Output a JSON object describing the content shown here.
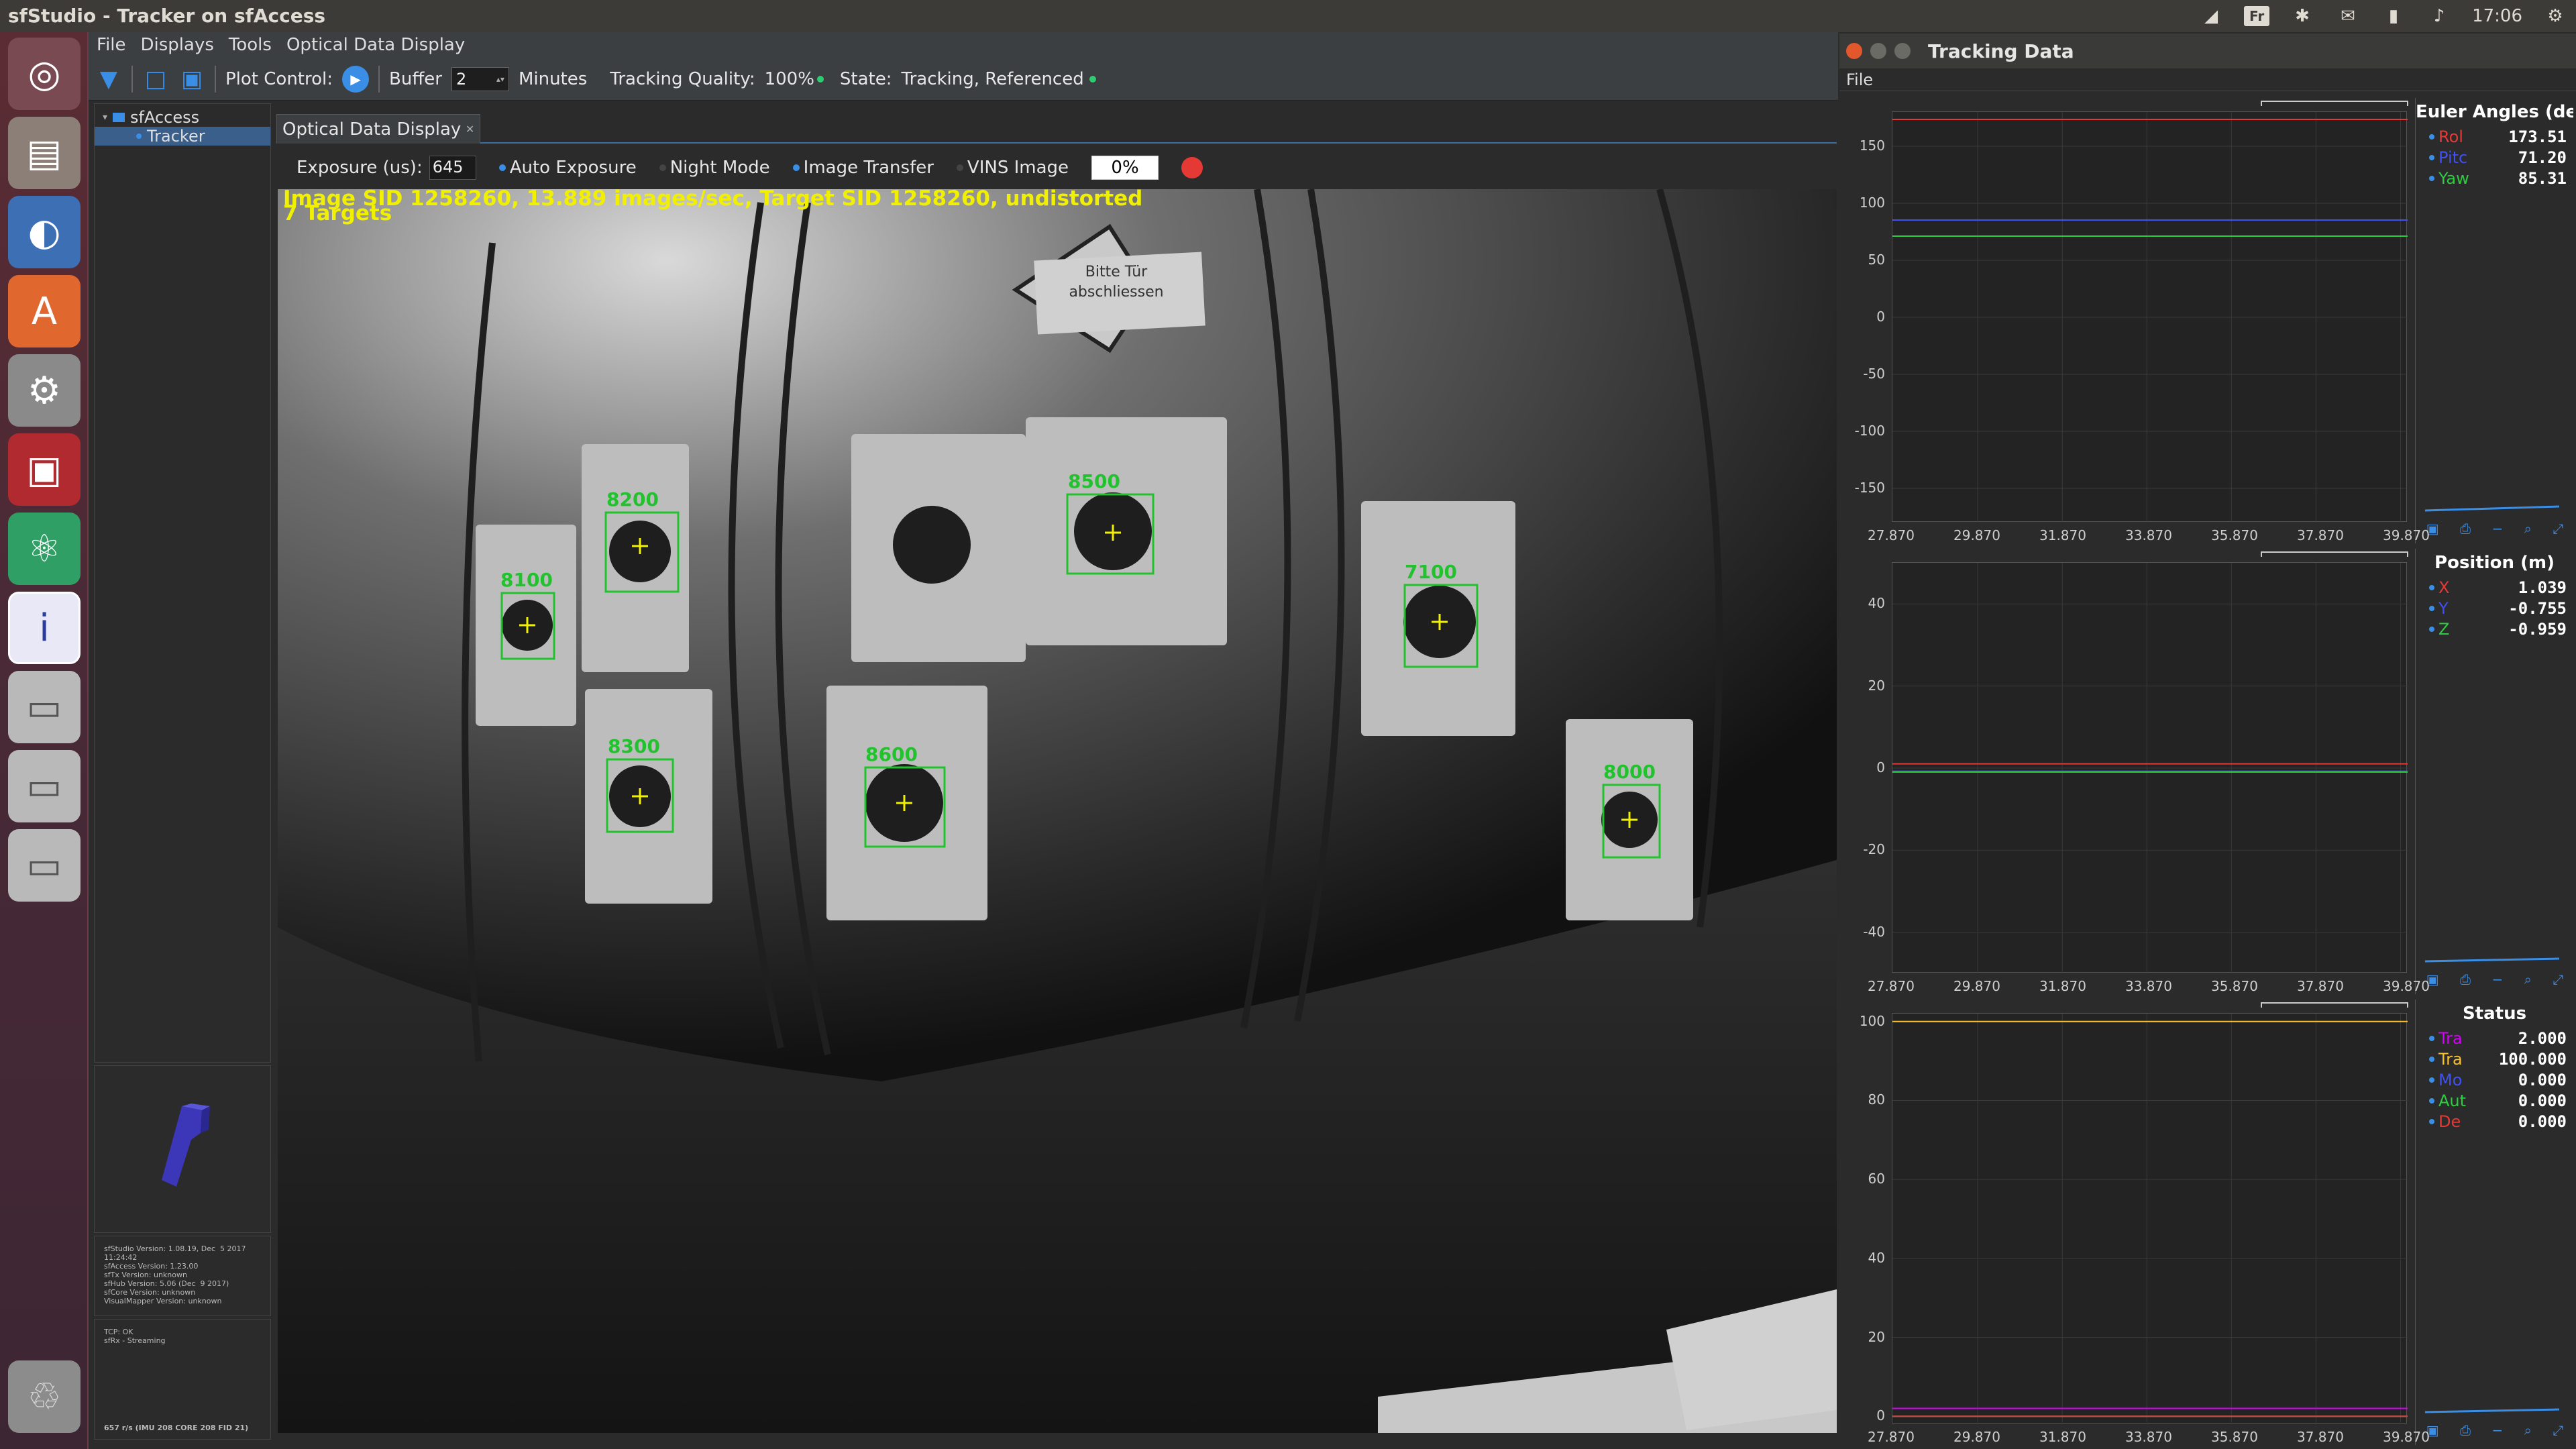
{
  "topbar": {
    "title": "sfStudio - Tracker on sfAccess",
    "keyboard": "Fr",
    "clock": "17:06"
  },
  "launcher": {
    "items": [
      "ubuntu-dash-icon",
      "files-icon",
      "firefox-icon",
      "software-center-icon",
      "system-settings-icon",
      "terminal-icon",
      "atom-icon",
      "sfstudio-icon",
      "drive-icon",
      "drive-icon",
      "drive-icon",
      "trash-icon"
    ]
  },
  "menubar": {
    "items": [
      "File",
      "Displays",
      "Tools",
      "Optical Data Display"
    ]
  },
  "toolbar": {
    "plot_control": "Plot Control:",
    "buffer": "Buffer",
    "buffer_value": "2",
    "minutes": "Minutes",
    "tracking_quality_label": "Tracking Quality:",
    "tracking_quality": "100%",
    "state_label": "State:",
    "state": "Tracking, Referenced"
  },
  "tree": {
    "root": "sfAccess",
    "child": "Tracker"
  },
  "versions": "sfStudio Version: 1.08.19, Dec  5 2017\n11:24:42\nsfAccess Version: 1.23.00\nsfTx Version: unknown\nsfHub Version: 5.06 (Dec  9 2017)\nsfCore Version: unknown\nVisualMapper Version: unknown",
  "status": {
    "tcp": "TCP: OK",
    "rx": "sfRx - Streaming",
    "rate": "657 r/s (IMU 208  CORE 208  FID 21)"
  },
  "optical": {
    "tab": "Optical Data Display",
    "exposure_label": "Exposure (us):",
    "exposure_value": "645",
    "auto_exposure": "Auto Exposure",
    "night_mode": "Night Mode",
    "image_transfer": "Image Transfer",
    "vins_image": "VINS Image",
    "progress": "0%",
    "overlay_line1": "Image SID 1258260, 13.889 images/sec, Target SID 1258260, undistorted",
    "overlay_line2": "7 Targets",
    "sign_text": [
      "Bitte Tür",
      "abschliessen"
    ],
    "targets": [
      "8100",
      "8200",
      "8300",
      "8500",
      "8600",
      "7100",
      "8000"
    ]
  },
  "tracking": {
    "title": "Tracking Data",
    "menu": "File",
    "x_ticks": [
      "27.870",
      "29.870",
      "31.870",
      "33.870",
      "35.870",
      "37.870",
      "39.870"
    ],
    "euler": {
      "title": "Euler Angles (de",
      "rows": [
        {
          "name": "Rol",
          "value": "173.51",
          "color": "#e53935"
        },
        {
          "name": "Pitc",
          "value": "71.20",
          "color": "#3f51f5"
        },
        {
          "name": "Yaw",
          "value": "85.31",
          "color": "#2ecc40"
        }
      ],
      "y_ticks": [
        "150",
        "100",
        "50",
        "0",
        "-50",
        "-100",
        "-150"
      ],
      "ylim": [
        -180,
        180
      ],
      "lines": [
        173.51,
        85.31,
        71.2
      ]
    },
    "position": {
      "title": "Position (m)",
      "rows": [
        {
          "name": "X",
          "value": "1.039",
          "color": "#e53935"
        },
        {
          "name": "Y",
          "value": "-0.755",
          "color": "#3f51f5"
        },
        {
          "name": "Z",
          "value": "-0.959",
          "color": "#2ecc40"
        }
      ],
      "y_ticks": [
        "40",
        "20",
        "0",
        "-20",
        "-40"
      ],
      "ylim": [
        -50,
        50
      ],
      "lines": [
        1.039,
        -0.755,
        -0.959
      ]
    },
    "status": {
      "title": "Status",
      "rows": [
        {
          "name": "Tra",
          "value": "2.000",
          "color": "#d500f9"
        },
        {
          "name": "Tra",
          "value": "100.000",
          "color": "#fbc02d"
        },
        {
          "name": "Mo",
          "value": "0.000",
          "color": "#3f51f5"
        },
        {
          "name": "Aut",
          "value": "0.000",
          "color": "#2ecc40"
        },
        {
          "name": "De",
          "value": "0.000",
          "color": "#e53935"
        }
      ],
      "y_ticks": [
        "100",
        "80",
        "60",
        "40",
        "20",
        "0"
      ],
      "ylim": [
        -2,
        102
      ],
      "lines": [
        2,
        100,
        0,
        0,
        0
      ]
    }
  }
}
